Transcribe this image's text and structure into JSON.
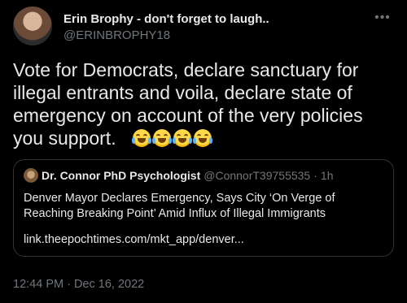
{
  "author": {
    "display_name": "Erin Brophy - don't forget to laugh..",
    "handle": "@ERINBROPHY18"
  },
  "more_icon": "more-horizontal-icon",
  "tweet": {
    "text": "Vote for Democrats, declare sanctuary for illegal entrants and voila, declare state of emergency on account of the very policies you support.",
    "emoji_count": 4,
    "emoji_name": "face-with-tears-of-joy-icon"
  },
  "quoted_tweet": {
    "display_name": "Dr. Connor PhD Psychologist",
    "handle": "@ConnorT39755535",
    "separator": "·",
    "time": "1h",
    "text": "Denver Mayor Declares Emergency, Says City ‘On Verge of Reaching Breaking Point’ Amid Influx of Illegal Immigrants",
    "link": "link.theepochtimes.com/mkt_app/denver..."
  },
  "timestamp": "12:44 PM · Dec 16, 2022",
  "colors": {
    "background": "#000000",
    "primary_text": "#e7e9ea",
    "secondary_text": "#71767b",
    "border": "#2f3336"
  }
}
